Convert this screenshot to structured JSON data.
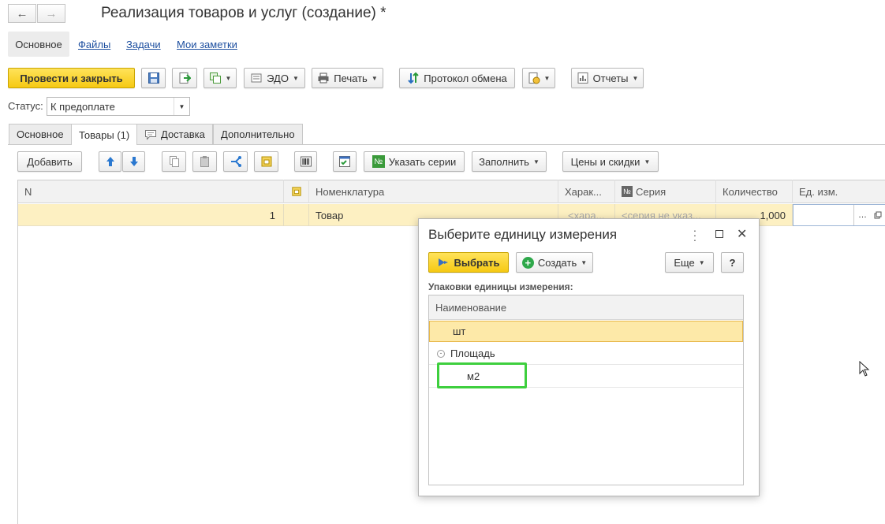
{
  "window": {
    "title": "Реализация товаров и услуг (создание) *"
  },
  "nav": {
    "back_icon": "arrow-left-icon",
    "forward_icon": "arrow-right-icon"
  },
  "top_tabs": [
    "Основное",
    "Файлы",
    "Задачи",
    "Мои заметки"
  ],
  "toolbar": {
    "post_close": "Провести и закрыть",
    "edo": "ЭДО",
    "print": "Печать",
    "exchange_log": "Протокол обмена",
    "reports": "Отчеты"
  },
  "status": {
    "label": "Статус:",
    "value": "К предоплате"
  },
  "tabs": [
    "Основное",
    "Товары (1)",
    "Доставка",
    "Дополнительно"
  ],
  "grid_toolbar": {
    "add": "Добавить",
    "series": "Указать серии",
    "fill": "Заполнить",
    "prices": "Цены и скидки"
  },
  "table": {
    "columns": [
      "N",
      "Номенклатура",
      "Харак...",
      "Серия",
      "Количество",
      "Ед. изм."
    ],
    "rows": [
      {
        "n": "1",
        "item": "Товар",
        "char": "<хара...",
        "series": "<серия не указ...",
        "qty": "1,000",
        "unit": ""
      }
    ]
  },
  "dialog": {
    "title": "Выберите единицу измерения",
    "choose": "Выбрать",
    "create": "Создать",
    "more": "Еще",
    "help": "?",
    "section_label": "Упаковки единицы измерения:",
    "column": "Наименование",
    "items": [
      "шт"
    ],
    "group": "Площадь",
    "group_items": [
      "м2"
    ]
  },
  "colors": {
    "accent_yellow": "#f6c913",
    "selected_row": "#fde9a8",
    "highlight_green": "#3ecf3e",
    "link_blue": "#1c4e9f"
  }
}
